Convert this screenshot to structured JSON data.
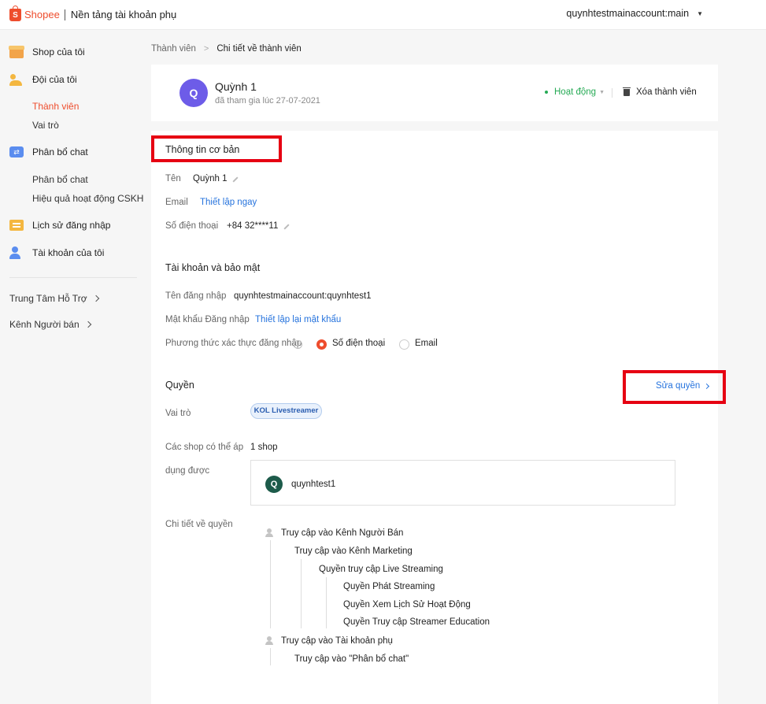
{
  "header": {
    "logo_text": "Shopee",
    "platform_title": "Nền tảng tài khoản phụ",
    "account_name": "quynhtestmainaccount:main"
  },
  "sidebar": {
    "items": [
      {
        "label": "Shop của tôi",
        "icon": "store-icon"
      },
      {
        "label": "Đội của tôi",
        "icon": "team-icon"
      },
      {
        "label": "Phân bổ chat",
        "icon": "chat-icon"
      },
      {
        "label": "Lịch sử đăng nhập",
        "icon": "history-icon"
      },
      {
        "label": "Tài khoản của tôi",
        "icon": "account-icon"
      }
    ],
    "team_sub": [
      "Thành viên",
      "Vai trò"
    ],
    "chat_sub": [
      "Phân bổ chat",
      "Hiệu quả hoạt động CSKH"
    ],
    "links": [
      "Trung Tâm Hỗ Trợ",
      "Kênh Người bán"
    ]
  },
  "breadcrumb": {
    "parent": "Thành viên",
    "current": "Chi tiết về thành viên"
  },
  "member": {
    "avatar_letter": "Q",
    "name": "Quỳnh 1",
    "joined": "đã tham gia lúc 27-07-2021",
    "status": "Hoạt động",
    "delete_label": "Xóa thành viên"
  },
  "basic_info": {
    "title": "Thông tin cơ bản",
    "name_label": "Tên",
    "name_value": "Quỳnh 1",
    "email_label": "Email",
    "email_link": "Thiết lập ngay",
    "phone_label": "Số điện thoại",
    "phone_value": "+84 32****11"
  },
  "security": {
    "title": "Tài khoản và bảo mật",
    "username_label": "Tên đăng nhập",
    "username_value": "quynhtestmainaccount:quynhtest1",
    "password_label": "Mật khẩu Đăng nhập",
    "password_link": "Thiết lập lại mật khẩu",
    "auth_label": "Phương thức xác thực đăng nhập",
    "auth_options": [
      "Số điện thoại",
      "Email"
    ],
    "auth_selected": "Số điện thoại"
  },
  "permissions": {
    "title": "Quyền",
    "edit_label": "Sửa quyền",
    "role_label": "Vai trò",
    "role_value": "KOL Livestreamer",
    "shops_label_1": "Các shop có thể áp",
    "shops_label_2": "dụng được",
    "shop_count": "1 shop",
    "shop_avatar_letter": "Q",
    "shop_name": "quynhtest1",
    "details_label": "Chi tiết về quyền",
    "tree": [
      "Truy cập vào Kênh Người Bán",
      "Truy cập vào Kênh Marketing",
      "Quyền truy cập Live Streaming",
      "Quyền Phát Streaming",
      "Quyền Xem Lịch Sử Hoạt Động",
      "Quyền Truy cập Streamer Education",
      "Truy cập vào Tài khoản phụ",
      "Truy cập vào \"Phân bổ chat\""
    ]
  },
  "colors": {
    "brand": "#ee4d2d",
    "link": "#2673dd",
    "status_active": "#26aa55",
    "highlight_box": "#e60012"
  }
}
